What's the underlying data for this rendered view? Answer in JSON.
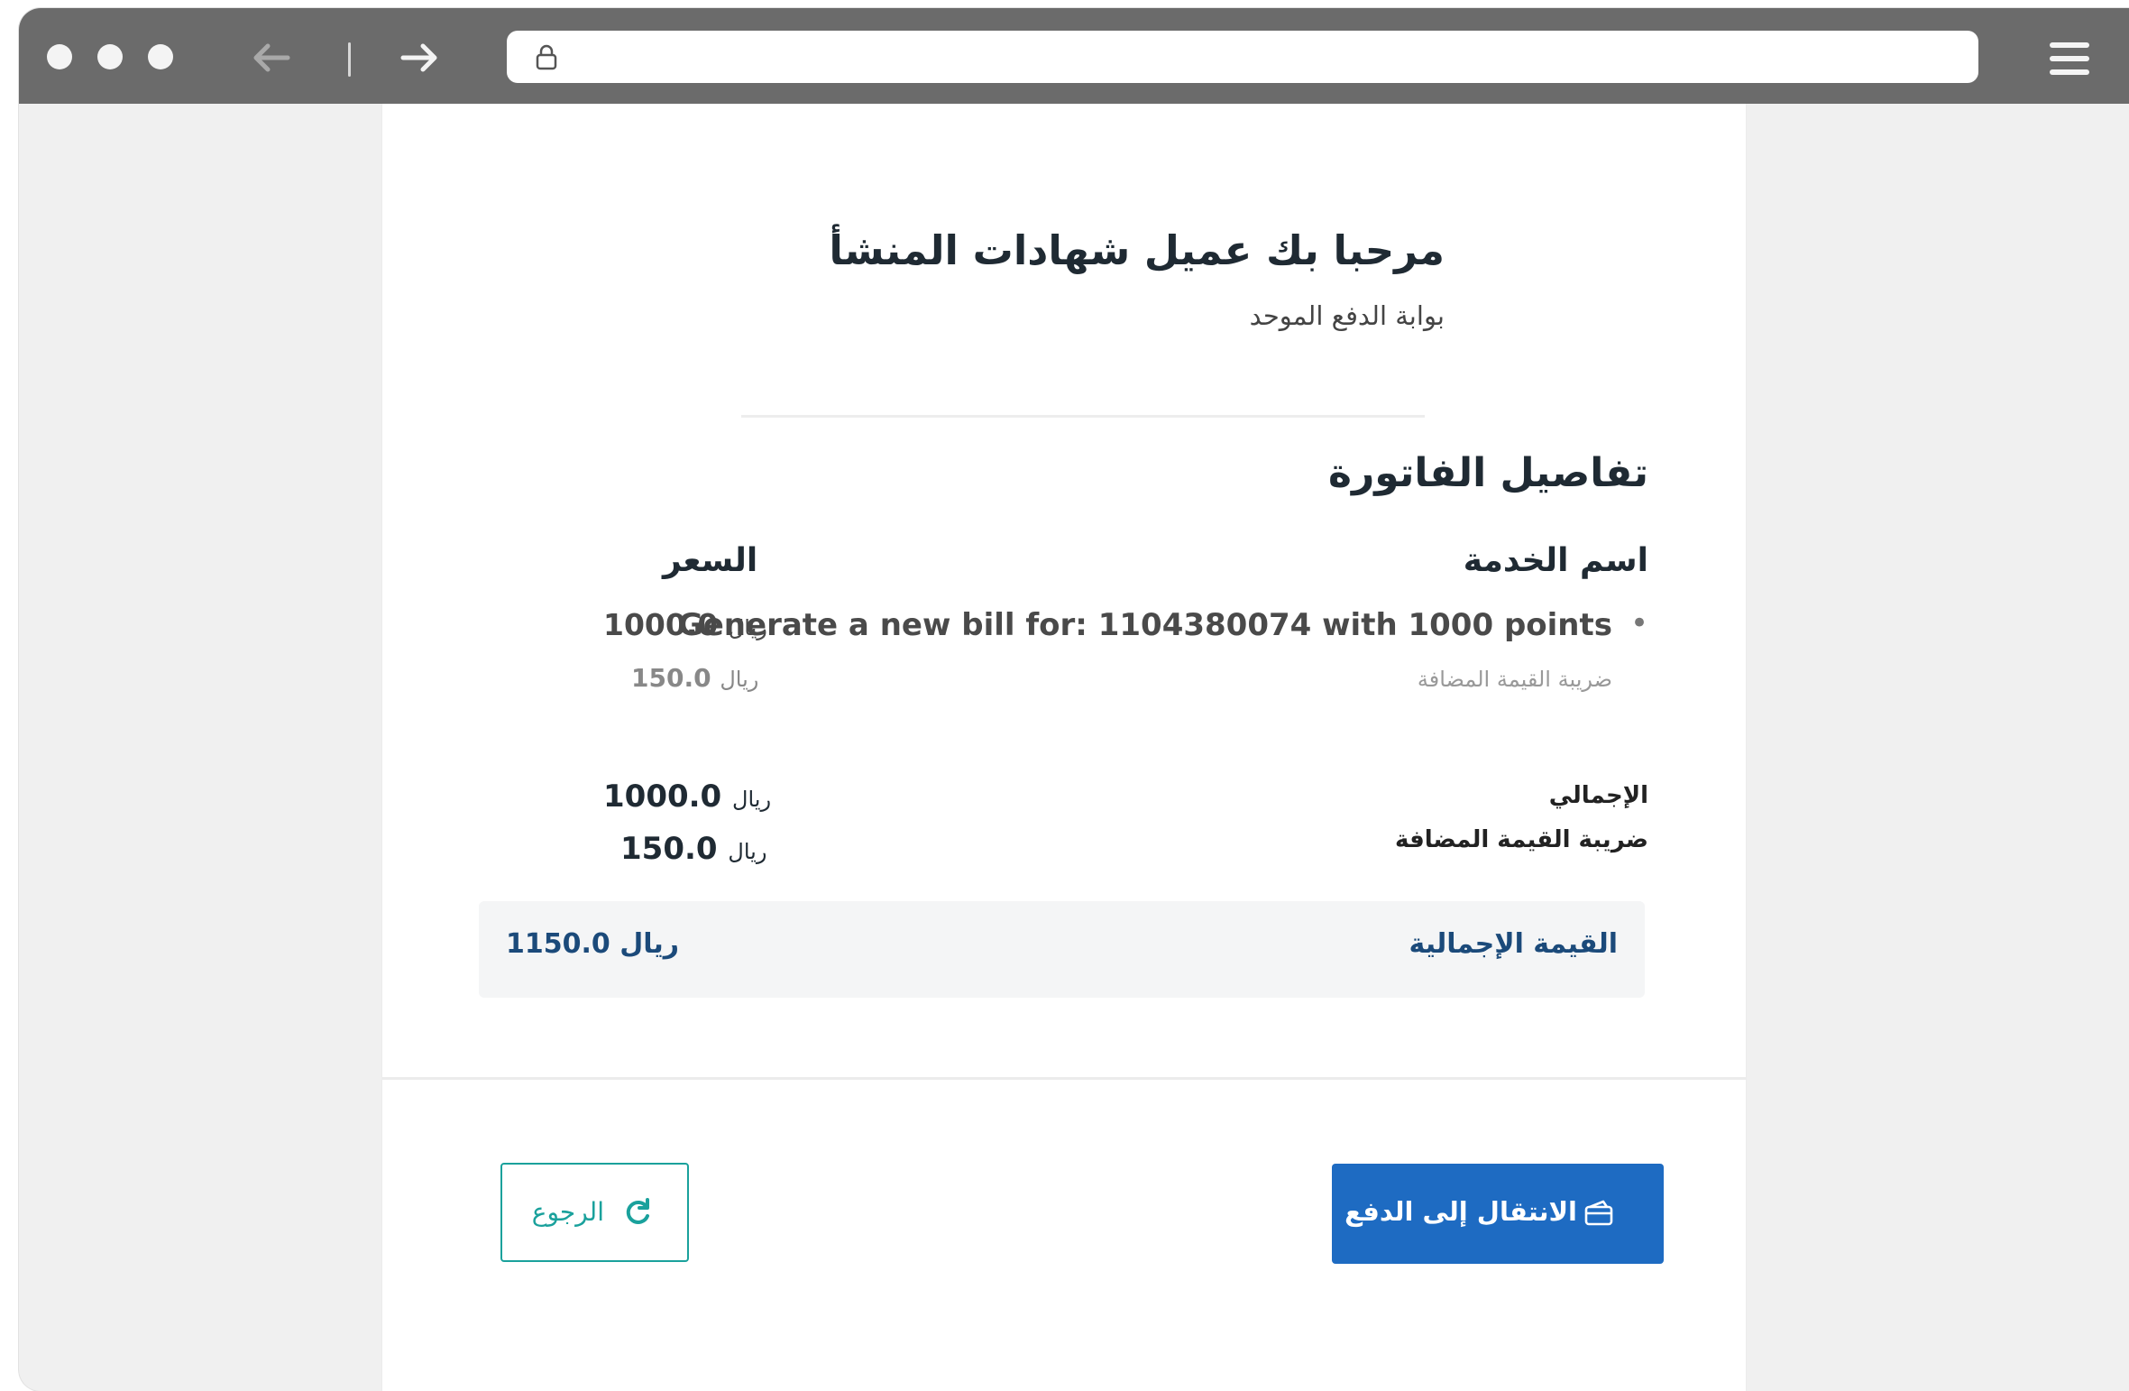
{
  "browser": {
    "window_buttons": [
      "close",
      "minimize",
      "maximize"
    ],
    "url": ""
  },
  "header": {
    "welcome": "مرحبا بك عميل شهادات المنشأ",
    "portal": "بوابة الدفع الموحد"
  },
  "invoice": {
    "title": "تفاصيل الفاتورة",
    "column_service": "اسم الخدمة",
    "column_price": "السعر",
    "items": [
      {
        "bullet": "•",
        "name": "Generate a new bill for: 1104380074 with 1000 points",
        "vat_label": "ضريبة القيمة المضافة",
        "price": "1000.0",
        "vat": "150.0"
      }
    ],
    "currency": "ريال",
    "subtotal_label": "الإجمالي",
    "subtotal": "1000.0",
    "vat_label": "ضريبة القيمة المضافة",
    "vat": "150.0",
    "total_label": "القيمة الإجمالية",
    "total": "1150.0"
  },
  "actions": {
    "pay_label": "الانتقال إلى الدفع",
    "back_label": "الرجوع"
  },
  "colors": {
    "chrome": "#6b6b6b",
    "primary": "#1e6bc2",
    "teal": "#1aa19c",
    "total_text": "#1b4a7a"
  }
}
